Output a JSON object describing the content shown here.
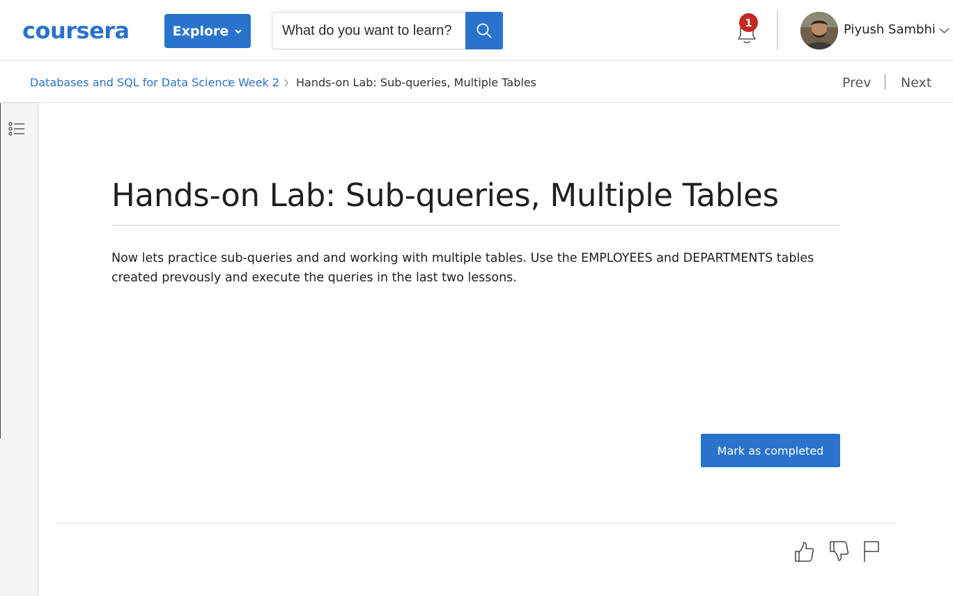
{
  "header": {
    "logo_text": "coursera",
    "explore_label": "Explore",
    "search": {
      "placeholder": "What do you want to learn?",
      "value": ""
    },
    "notifications": {
      "count": "1"
    },
    "user": {
      "name": "Piyush Sambhi"
    }
  },
  "breadcrumb": {
    "items": [
      {
        "label": "Databases and SQL for Data Science"
      },
      {
        "label": "Week 2"
      },
      {
        "label": "Hands-on Lab: Sub-queries, Multiple Tables"
      }
    ],
    "prev_label": "Prev",
    "next_label": "Next"
  },
  "content": {
    "title": "Hands-on Lab: Sub-queries, Multiple Tables",
    "body": "Now lets practice sub-queries and and working with multiple tables. Use the EMPLOYEES and DEPARTMENTS tables created prevously and execute the queries in the last two lessons.",
    "mark_complete_label": "Mark as completed"
  },
  "colors": {
    "brand_blue": "#2a73cc",
    "badge_red": "#c6271e"
  },
  "icons": [
    "search-icon",
    "bell-icon",
    "chevron-down-icon",
    "list-icon",
    "thumbs-up-icon",
    "thumbs-down-icon",
    "flag-icon"
  ]
}
